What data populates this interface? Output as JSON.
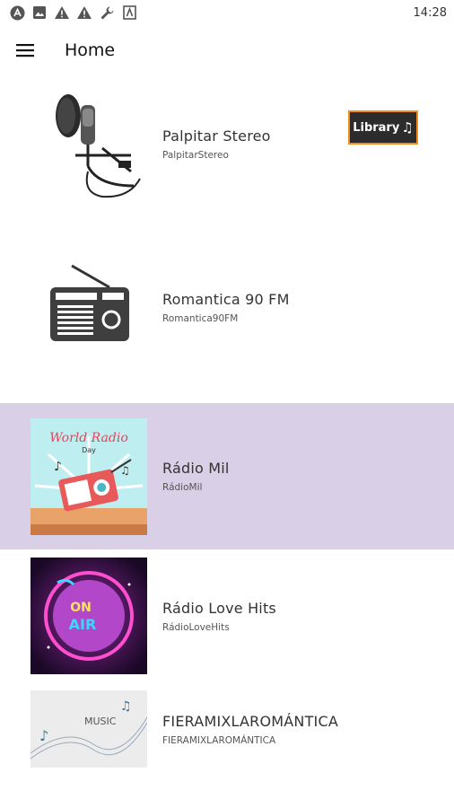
{
  "status_bar": {
    "time": "14:28",
    "icons": [
      "app-notification-icon",
      "image-icon",
      "warning-icon",
      "warning-icon",
      "wrench-icon",
      "app-icon"
    ]
  },
  "app_bar": {
    "title": "Home",
    "menu_icon": "menu-icon"
  },
  "library_button": {
    "label": "Library",
    "icon": "music-note-icon",
    "note_glyph": "♫"
  },
  "stations": [
    {
      "title": "Palpitar Stereo",
      "subtitle": "PalpitarStereo",
      "image": "microphone-thumbnail",
      "selected": false
    },
    {
      "title": "Romantica 90 FM",
      "subtitle": "Romantica90FM",
      "image": "radio-thumbnail",
      "selected": false
    },
    {
      "title": "Rádio Mil",
      "subtitle": "RádioMil",
      "image": "world-radio-day-thumbnail",
      "image_text": "World Radio",
      "image_text2": "Day",
      "selected": true
    },
    {
      "title": "Rádio Love Hits",
      "subtitle": "RádioLoveHits",
      "image": "on-air-thumbnail",
      "image_text": "ON",
      "image_text2": "AIR",
      "selected": false
    },
    {
      "title": "FIERAMIXLAROMÁNTICA",
      "subtitle": "FIERAMIXLAROMÁNTICA",
      "image": "music-thumbnail",
      "image_text": "MUSIC",
      "selected": false
    }
  ],
  "colors": {
    "selected_row": "#d9cfe6",
    "library_border": "#f28c1c",
    "library_bg": "#2c2c2c"
  }
}
